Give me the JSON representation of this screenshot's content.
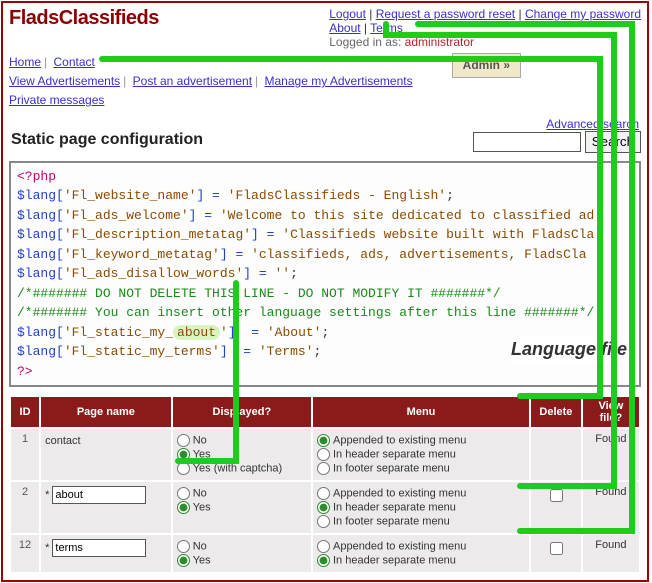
{
  "brand": "FladsClassifieds",
  "top_links": {
    "logout": "Logout",
    "reset_pw": "Request a password reset",
    "change_pw": "Change my password",
    "about": "About",
    "terms": "Terms",
    "logged_in_as_label": "Logged in as:",
    "logged_in_user": "administrator"
  },
  "nav": {
    "home": "Home",
    "contact": "Contact",
    "admin_btn": "Admin »",
    "view_ads": "View Advertisements",
    "post_ad": "Post an advertisement",
    "manage_ads": "Manage my Advertisements",
    "pm": "Private messages"
  },
  "section_title": "Static page configuration",
  "adv_search": "Advanced search",
  "search_btn": "Search",
  "code": {
    "open": "<?php",
    "l1a": "$lang[",
    "l1b": "'Fl_website_name'",
    "l1c": "] = ",
    "l1d": "'FladsClassifieds - English'",
    "l1e": ";",
    "l2a": "$lang[",
    "l2b": "'Fl_ads_welcome'",
    "l2c": "] = ",
    "l2d": "'Welcome to this site dedicated to classified ad",
    "l2e": "",
    "l3a": "$lang[",
    "l3b": "'Fl_description_metatag'",
    "l3c": "] = ",
    "l3d": "'Classifieds website built with FladsCla",
    "l3e": "",
    "l4a": "$lang[",
    "l4b": "'Fl_keyword_metatag'",
    "l4c": "] = ",
    "l4d": "'classifieds, ads, advertisements, FladsCla",
    "l4e": "",
    "l5a": "$lang[",
    "l5b": "'Fl_ads_disallow_words'",
    "l5c": "] = ",
    "l5d": "''",
    "l5e": ";",
    "c1": "/*####### DO NOT DELETE THIS LINE - DO NOT MODIFY IT #######*/",
    "c2": "/*####### You can insert other language settings after this line #######*/",
    "l6a": "$lang[",
    "l6b": "'Fl_static_my_",
    "l6hl": "about",
    "l6b2": "'",
    "l6c": "]  = ",
    "l6d": "'About'",
    "l6e": ";",
    "l7a": "$lang[",
    "l7b": "'Fl_static_my_terms'",
    "l7c": "]  = ",
    "l7d": "'Terms'",
    "l7e": ";",
    "close": "?>",
    "lflabel": "Language file"
  },
  "table": {
    "headers": {
      "id": "ID",
      "name": "Page name",
      "disp": "Displayed?",
      "menu": "Menu",
      "del": "Delete",
      "vf": "View file?"
    },
    "disp_opts": {
      "no": "No",
      "yes": "Yes",
      "yc": "Yes (with captcha)"
    },
    "menu_opts": {
      "app": "Appended to existing menu",
      "hdr": "In header separate menu",
      "ftr": "In footer separate menu"
    },
    "found": "Found",
    "rows": [
      {
        "id": "1",
        "name": "contact",
        "editable": false,
        "disp": "yes",
        "menu": "app",
        "show_del": false
      },
      {
        "id": "2",
        "name": "about",
        "editable": true,
        "disp": "yes",
        "menu": "hdr",
        "show_del": true
      },
      {
        "id": "12",
        "name": "terms",
        "editable": true,
        "disp": "yes",
        "menu": "hdr",
        "show_del": true
      }
    ]
  }
}
